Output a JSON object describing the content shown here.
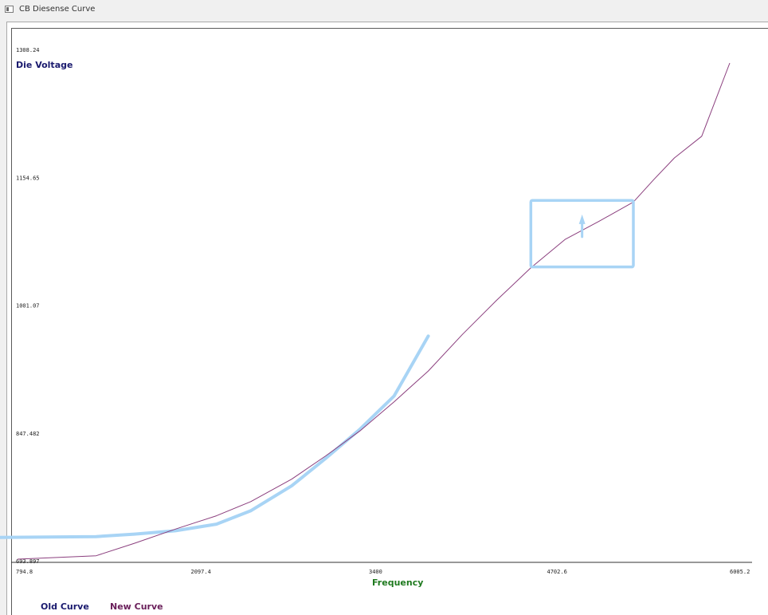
{
  "window": {
    "title": "CB Diesense Curve",
    "icon": "app-window-icon"
  },
  "colors": {
    "new_curve": "#8b3f7e",
    "old_curve_highlight": "#a8d4f5",
    "y_label": "#1a1a6e",
    "x_label": "#1f7a1f",
    "legend_old": "#1a1a6e",
    "legend_new": "#6a1f5a"
  },
  "chart_data": {
    "type": "line",
    "title": "",
    "xlabel": "Frequency",
    "ylabel": "Die Voltage",
    "xlim": [
      794.8,
      6005.2
    ],
    "ylim": [
      693.897,
      1308.24
    ],
    "x_ticks": [
      "794.8",
      "2097.4",
      "3400",
      "4702.6",
      "6005.2"
    ],
    "y_ticks": [
      "1308.24",
      "1154.65",
      "1001.07",
      "847.482",
      "693.897"
    ],
    "legend": [
      "Old Curve",
      "New Curve"
    ],
    "series": [
      {
        "name": "New Curve",
        "x": [
          794.8,
          1370,
          1650,
          1950,
          2250,
          2500,
          2800,
          3050,
          3300,
          3550,
          3800,
          4050,
          4300,
          4550,
          4800,
          5050,
          5300,
          5450,
          5600,
          5800,
          6005.2
        ],
        "y": [
          693.897,
          698,
          713,
          730,
          746,
          763,
          790,
          818,
          848,
          883,
          920,
          964,
          1005,
          1044,
          1078,
          1100,
          1123,
          1150,
          1176,
          1202,
          1290
        ]
      },
      {
        "name": "Old Curve",
        "x": [
          630,
          1370,
          1650,
          1950,
          2250,
          2500,
          2800,
          3050,
          3300,
          3550,
          3800
        ],
        "y": [
          720,
          721,
          724,
          728,
          736,
          752,
          782,
          815,
          850,
          890,
          962
        ]
      }
    ]
  },
  "annotation": {
    "shape": "rectangle-with-arrow",
    "around_x": [
      4550,
      5300
    ],
    "around_y": [
      1045,
      1125
    ]
  }
}
